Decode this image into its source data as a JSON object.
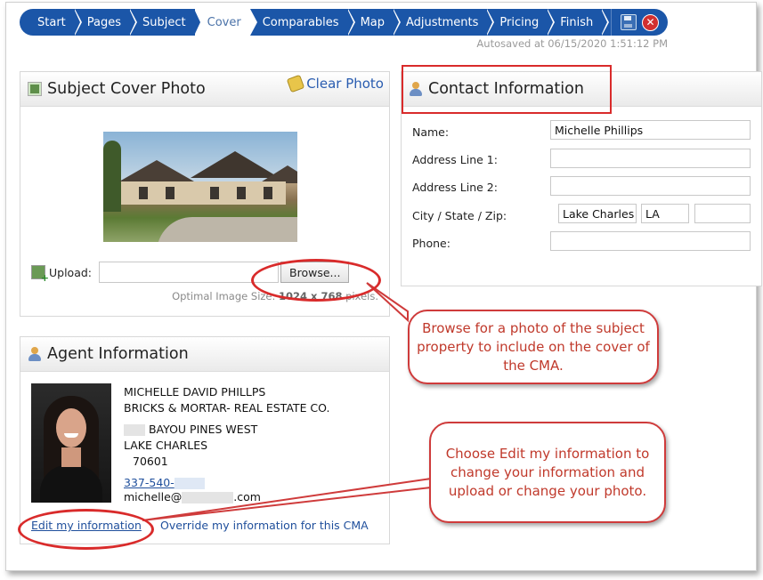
{
  "nav": {
    "steps": [
      "Start",
      "Pages",
      "Subject",
      "Cover",
      "Comparables",
      "Map",
      "Adjustments",
      "Pricing",
      "Finish"
    ],
    "active_step": "Cover",
    "save_icon": "save-disk-icon",
    "close_icon": "close-circle-icon"
  },
  "autosave": "Autosaved at 06/15/2020 1:51:12 PM",
  "cover_photo": {
    "title": "Subject Cover Photo",
    "clear_label": "Clear Photo",
    "upload_label": "Upload:",
    "upload_value": "",
    "browse_label": "Browse...",
    "optimal_prefix": "Optimal Image Size: ",
    "optimal_size": "1024 x 768",
    "optimal_suffix": " pixels."
  },
  "contact": {
    "title": "Contact Information",
    "name_label": "Name:",
    "name_value": "Michelle Phillips",
    "address1_label": "Address Line 1:",
    "address1_value": "",
    "address2_label": "Address Line 2:",
    "address2_value": "",
    "csz_label": "City / State / Zip:",
    "city_value": "Lake Charles",
    "state_value": "LA",
    "zip_value": "",
    "phone_label": "Phone:",
    "phone_value": ""
  },
  "agent": {
    "title": "Agent Information",
    "name": "MICHELLE DAVID PHILLPS",
    "company": "BRICKS & MORTAR- REAL ESTATE CO.",
    "street": "BAYOU PINES WEST",
    "city": "LAKE CHARLES",
    "zip": "70601",
    "phone_prefix": "337-540-",
    "email_prefix": "michelle@",
    "email_suffix": ".com",
    "edit_label": "Edit my information",
    "override_label": "Override my information for this CMA"
  },
  "callouts": {
    "browse": "Browse for a photo of the subject property to include on the cover of the CMA.",
    "edit": "Choose Edit my information to change your information and upload or change your photo."
  },
  "colors": {
    "nav_blue": "#1b56a8",
    "annotation_red": "#d92b2b",
    "link_blue": "#1f4f9c"
  }
}
